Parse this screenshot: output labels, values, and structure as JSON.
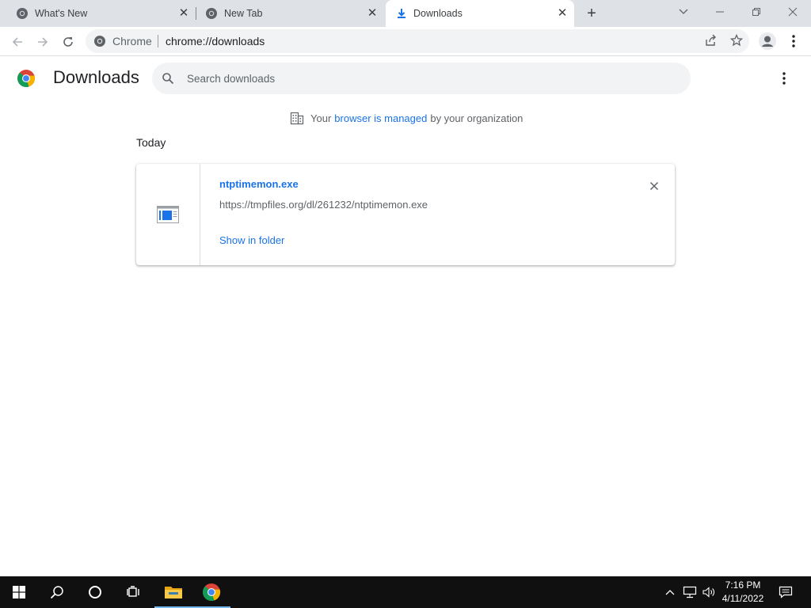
{
  "tabs": [
    {
      "title": "What's New",
      "icon": "chrome-logo-icon",
      "active": false
    },
    {
      "title": "New Tab",
      "icon": "chrome-logo-icon",
      "active": false
    },
    {
      "title": "Downloads",
      "icon": "download-arrow-icon",
      "active": true
    }
  ],
  "toolbar": {
    "chip_label": "Chrome",
    "url": "chrome://downloads"
  },
  "page": {
    "title": "Downloads",
    "search_placeholder": "Search downloads",
    "managed_prefix": "Your",
    "managed_link": "browser is managed",
    "managed_suffix": "by your organization",
    "section_date": "Today"
  },
  "downloads": [
    {
      "file_name": "ntptimemon.exe",
      "url": "https://tmpfiles.org/dl/261232/ntptimemon.exe",
      "action_label": "Show in folder"
    }
  ],
  "taskbar": {
    "time": "7:16 PM",
    "date": "4/11/2022",
    "pinned": [
      "start-icon",
      "search-icon",
      "cortana-icon",
      "task-view-icon",
      "file-explorer-icon",
      "chrome-icon"
    ]
  },
  "colors": {
    "accent": "#1a73e8",
    "tabstrip": "#dee1e6",
    "taskbar": "#101010"
  }
}
